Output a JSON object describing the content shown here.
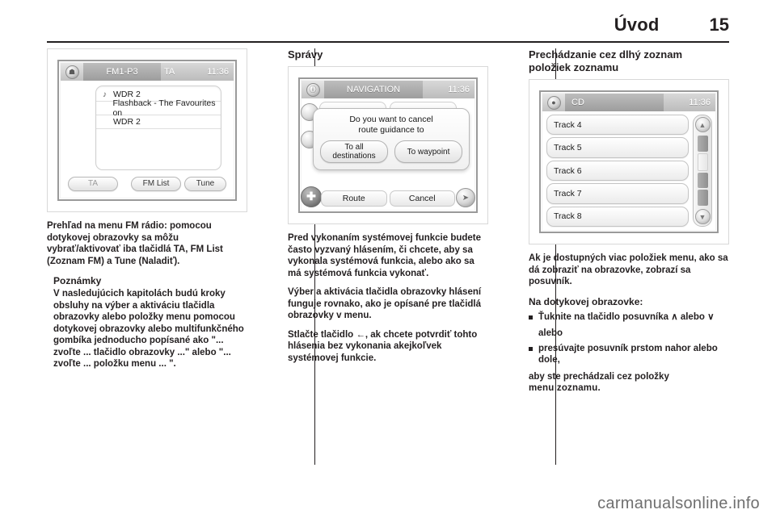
{
  "header": {
    "title": "Úvod",
    "page_number": "15"
  },
  "watermark": "carmanualsonline.info",
  "left_column": {
    "figure": {
      "name": "fm-radio-screen",
      "titlebar": {
        "home_icon": "home-icon",
        "source": "FM1-P3",
        "ta_label": "TA",
        "clock": "11:36"
      },
      "rows": [
        {
          "icon": "music-note-icon",
          "text": "WDR 2"
        },
        {
          "icon": "",
          "text": "Flashback - The Favourites on"
        },
        {
          "icon": "",
          "text": "WDR 2"
        }
      ],
      "buttons": {
        "ta": "TA",
        "fm_list": "FM List",
        "tune": "Tune"
      }
    },
    "lead": "Prehľad na menu FM rádio: pomocou dotykovej obrazovky sa môžu vybrať/aktivovať iba tlačidlá TA, FM List (Zoznam FM) a Tune (Naladiť).",
    "sub_heading": "Poznámky",
    "note": "V nasledujúcich kapitolách budú kroky obsluhy na výber a aktiváciu tlačidla obrazovky alebo položky menu pomocou dotykovej obrazovky alebo multifunkčného gombíka jednoducho popísané ako \"... zvoľte ... tlačidlo obrazovky ...\" alebo \"... zvoľte ... položku menu ... \"."
  },
  "mid_column": {
    "heading": "Správy",
    "figure": {
      "name": "navigation-screen",
      "titlebar": {
        "info_icon": "info-icon",
        "title": "NAVIGATION",
        "clock": "11:36"
      },
      "dialog": {
        "line1": "Do you want to cancel",
        "line2": "route guidance to",
        "buttons": [
          {
            "line1": "To all",
            "line2": "destinations"
          },
          {
            "line1": "To waypoint",
            "line2": ""
          }
        ]
      },
      "bottom_buttons": [
        "Route",
        "Cancel"
      ],
      "compass_icon": "compass-icon",
      "side_icons": [
        "circle-button-icon",
        "circle-button-icon"
      ],
      "right_icon": "arrow-button-icon"
    },
    "para1": "Pred vykonaním systémovej funkcie budete často vyzvaný hlásením, či chcete, aby sa vykonala systémová funkcia, alebo ako sa má systémová funkcia vykonať.",
    "para2": "Výber a aktivácia tlačidla obrazovky hlásení funguje rovnako, ako je opísané pre tlačidlá obrazovky v menu.",
    "para3": "Stlačte tlačidlo ←, ak chcete potvrdiť tohto hlásenia bez vykonania akejkoľvek systémovej funkcie."
  },
  "right_column": {
    "heading_line1": "Prechádzanie cez dlhý zoznam",
    "heading_line2": "položiek zoznamu",
    "figure": {
      "name": "cd-track-list-screen",
      "titlebar": {
        "cd_icon": "disc-icon",
        "title": "CD",
        "clock": "11:36"
      },
      "items": [
        "Track 4",
        "Track 5",
        "Track 6",
        "Track 7",
        "Track 8"
      ],
      "scrollbar": {
        "up_icon": "chevron-up-icon",
        "down_icon": "chevron-down-icon"
      }
    },
    "para1": "Ak je dostupných viac položiek menu, ako sa dá zobraziť na obrazovke, zobrazí sa posuvník.",
    "para2_heading": "Na dotykovej obrazovke:",
    "bullets": [
      "Ťuknite na tlačidlo posuvníka ∧ alebo ∨",
      "presúvajte posuvník prstom nahor alebo dole,"
    ],
    "or_label": "alebo",
    "closing_line1": "aby ste prechádzali cez položky",
    "closing_line2": "menu zoznamu."
  }
}
